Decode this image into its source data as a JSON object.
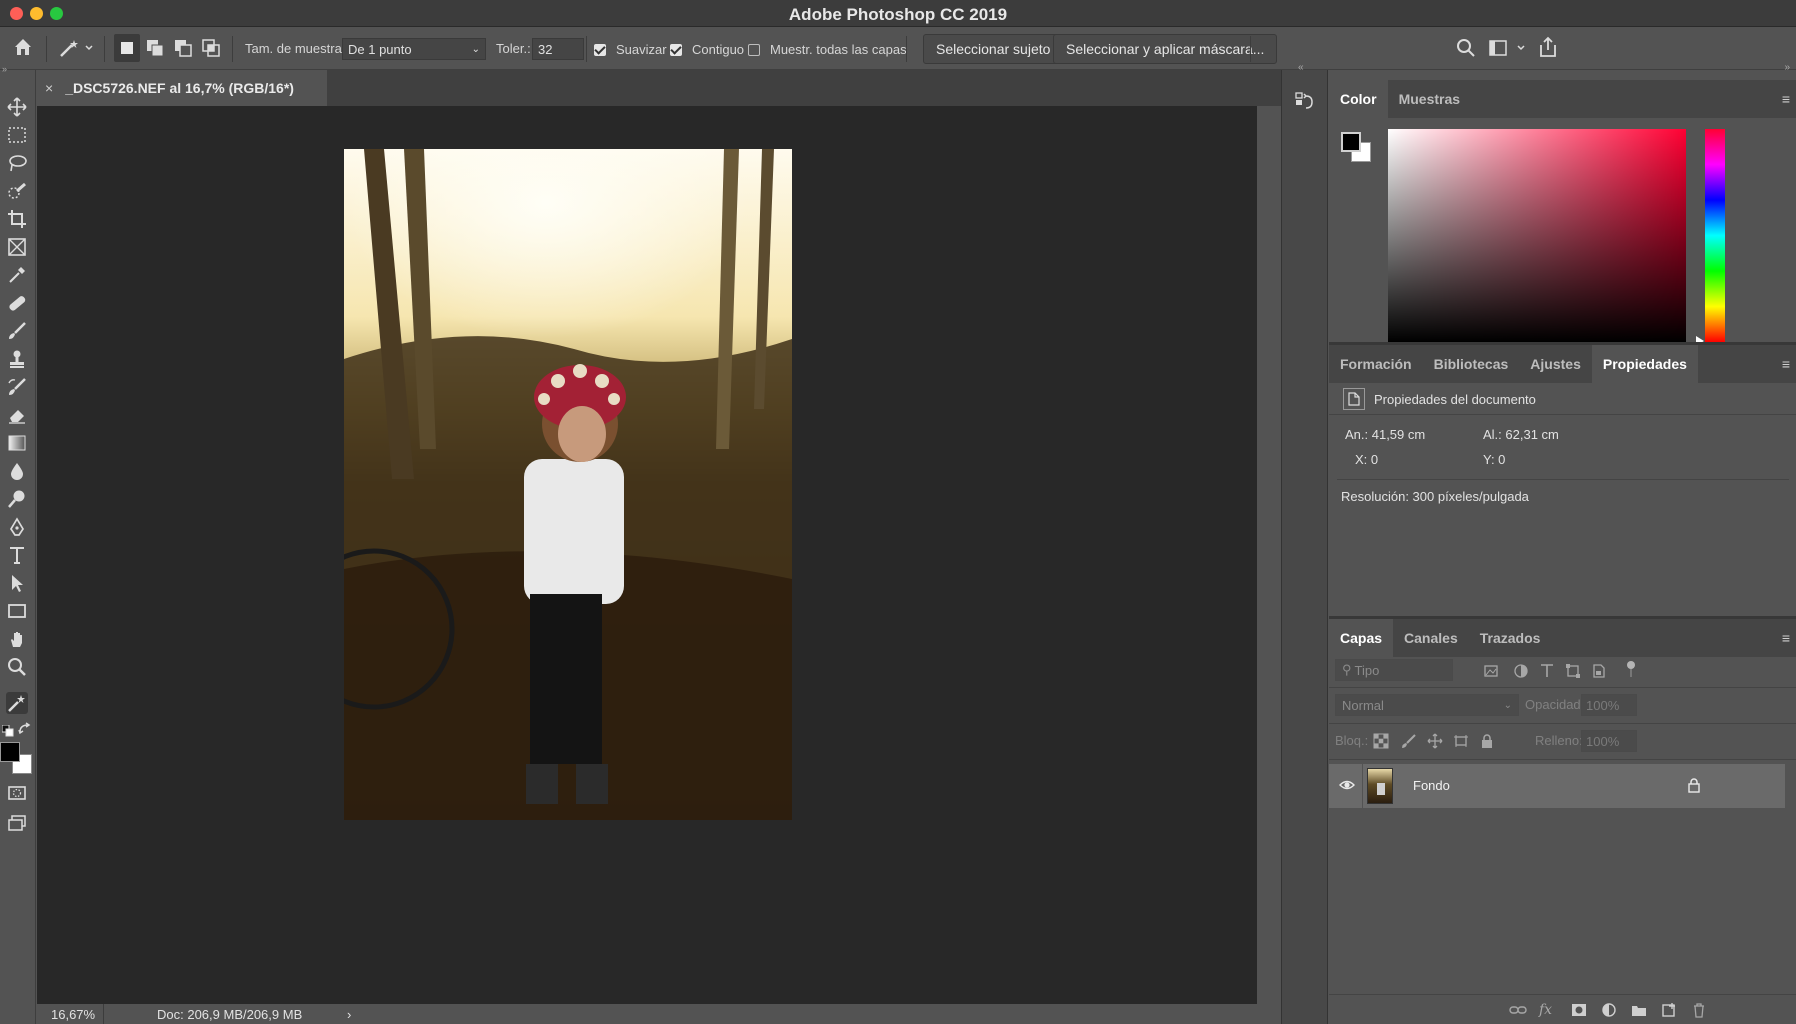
{
  "app": {
    "title": "Adobe Photoshop CC 2019"
  },
  "options_bar": {
    "sample_size_label": "Tam. de muestra:",
    "sample_size_value": "De 1 punto",
    "tolerance_label": "Toler.:",
    "tolerance_value": "32",
    "antialias_label": "Suavizar",
    "antialias_checked": true,
    "contiguous_label": "Contiguo",
    "contiguous_checked": true,
    "sample_all_layers_label": "Muestr. todas las capas",
    "sample_all_layers_checked": false,
    "select_subject_label": "Seleccionar sujeto",
    "select_and_mask_label": "Seleccionar y aplicar máscara..."
  },
  "document": {
    "tab_title": "_DSC5726.NEF al 16,7% (RGB/16*)",
    "close_glyph": "×"
  },
  "status_bar": {
    "zoom": "16,67%",
    "doc_size": "Doc: 206,9 MB/206,9 MB",
    "arrow": "›"
  },
  "color_panel": {
    "tabs": [
      "Color",
      "Muestras"
    ],
    "active_tab": "Color"
  },
  "properties_panel": {
    "tabs": [
      "Formación",
      "Bibliotecas",
      "Ajustes",
      "Propiedades"
    ],
    "active_tab": "Propiedades",
    "heading": "Propiedades del documento",
    "width": "An.: 41,59 cm",
    "height": "Al.: 62,31 cm",
    "x": "X: 0",
    "y": "Y: 0",
    "resolution": "Resolución: 300 píxeles/pulgada"
  },
  "layers_panel": {
    "tabs": [
      "Capas",
      "Canales",
      "Trazados"
    ],
    "active_tab": "Capas",
    "filter_placeholder": "Tipo",
    "blend_mode": "Normal",
    "opacity_label": "Opacidad:",
    "opacity_value": "100%",
    "lock_label": "Bloq.:",
    "fill_label": "Relleno:",
    "fill_value": "100%",
    "layers": [
      {
        "name": "Fondo",
        "visible": true,
        "locked": true
      }
    ]
  },
  "colors": {
    "ui_bg": "#535353",
    "canvas_bg": "#282828",
    "accent_red": "#ff0033",
    "foreground": "#000000",
    "background": "#ffffff"
  }
}
